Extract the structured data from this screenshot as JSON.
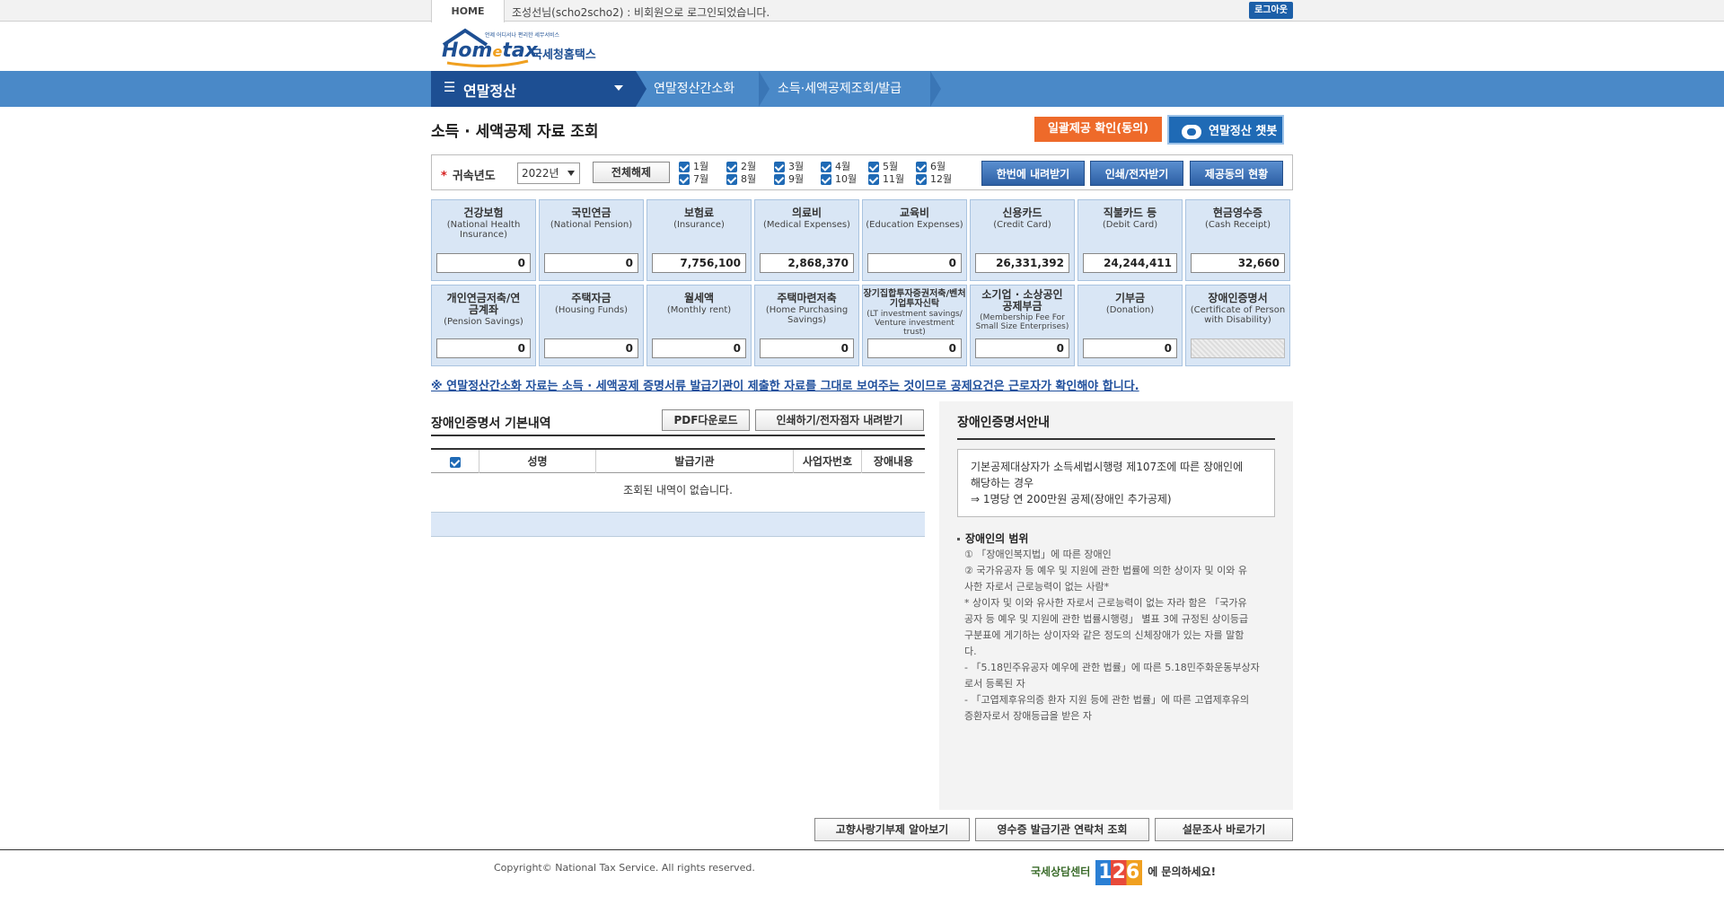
{
  "topbar": {
    "home": "HOME",
    "login_msg": "조성선님(scho2scho2) : 비회원으로 로그인되었습니다.",
    "logout": "로그아웃"
  },
  "logo": {
    "main_left": "Hom",
    "main_e": "e",
    "main_right": "tax",
    "korean": "국세청홈택스",
    "tagline": "언제 어디서나 편리한 세무서비스"
  },
  "nav": {
    "main": "연말정산",
    "crumbs": [
      "연말정산간소화",
      "소득·세액공제조회/발급"
    ]
  },
  "page": {
    "title": "소득 · 세액공제 자료 조회",
    "btn_consent": "일괄제공 확인(동의)",
    "btn_chatbot": "연말정산 챗봇"
  },
  "filter": {
    "label": "귀속년도",
    "year": "2022년",
    "btn_clear_all": "전체해제",
    "months": [
      "1월",
      "2월",
      "3월",
      "4월",
      "5월",
      "6월",
      "7월",
      "8월",
      "9월",
      "10월",
      "11월",
      "12월"
    ],
    "btn_download_all": "한번에 내려받기",
    "btn_print": "인쇄/전자받기",
    "btn_consent_status": "제공동의 현황"
  },
  "cards": [
    {
      "title": "건강보험",
      "en": "(National Health Insurance)",
      "value": "0"
    },
    {
      "title": "국민연금",
      "en": "(National Pension)",
      "value": "0"
    },
    {
      "title": "보험료",
      "en": "(Insurance)",
      "value": "7,756,100"
    },
    {
      "title": "의료비",
      "en": "(Medical Expenses)",
      "value": "2,868,370"
    },
    {
      "title": "교육비",
      "en": "(Education Expenses)",
      "value": "0"
    },
    {
      "title": "신용카드",
      "en": "(Credit Card)",
      "value": "26,331,392"
    },
    {
      "title": "직불카드 등",
      "en": "(Debit Card)",
      "value": "24,244,411"
    },
    {
      "title": "현금영수증",
      "en": "(Cash Receipt)",
      "value": "32,660"
    },
    {
      "title": "개인연금저축/연금계좌",
      "en": "(Pension Savings)",
      "value": "0"
    },
    {
      "title": "주택자금",
      "en": "(Housing Funds)",
      "value": "0"
    },
    {
      "title": "월세액",
      "en": "(Monthly rent)",
      "value": "0"
    },
    {
      "title": "주택마련저축",
      "en": "(Home Purchasing Savings)",
      "value": "0"
    },
    {
      "title": "장기집합투자증권저축/벤처기업투자신탁",
      "en": "(LT investment savings/ Venture investment trust)",
      "value": "0"
    },
    {
      "title": "소기업 · 소상공인 공제부금",
      "en": "(Membership Fee For Small Size Enterprises)",
      "value": "0"
    },
    {
      "title": "기부금",
      "en": "(Donation)",
      "value": "0"
    },
    {
      "title": "장애인증명서",
      "en": "(Certificate of Person with Disability)",
      "value": ""
    }
  ],
  "notice": "※ 연말정산간소화 자료는 소득 · 세액공제 증명서류 발급기관이 제출한 자료를 그대로 보여주는 것이므로 공제요건은 근로자가 확인해야 합니다.",
  "detail": {
    "title": "장애인증명서 기본내역",
    "btn_pdf": "PDF다운로드",
    "btn_print": "인쇄하기/전자점자 내려받기",
    "columns": [
      "성명",
      "발급기관",
      "사업자번호",
      "장애내용"
    ],
    "empty": "조회된 내역이 없습니다."
  },
  "guide": {
    "title": "장애인증명서안내",
    "box_line1": "기본공제대상자가 소득세법시행령 제107조에 따른 장애인에",
    "box_line2": "해당하는 경우",
    "box_line3": "⇒ 1명당 연 200만원 공제(장애인 추가공제)",
    "sub": "장애인의 범위",
    "lines": [
      "① 「장애인복지법」에 따른 장애인",
      "② 국가유공자 등 예우 및 지원에 관한 법률에 의한 상이자 및 이와 유",
      "사한 자로서 근로능력이 없는 사람*",
      "* 상이자 및 이와 유사한 자로서 근로능력이 없는 자라 함은 「국가유",
      "공자 등 예우 및 지원에 관한 법률시행령」 별표 3에 규정된 상이등급",
      "구분표에 게기하는 상이자와 같은 정도의 신체장애가 있는 자를 말함",
      "다.",
      "- 「5.18민주유공자 예우에 관한 법률」에 따른 5.18민주화운동부상자",
      "로서 등록된 자",
      "- 「고엽제후유의증 환자 지원 등에 관한 법률」에 따른 고엽제후유의",
      "증환자로서 장애등급을 받은 자"
    ]
  },
  "bottom_buttons": [
    "고향사랑기부제 알아보기",
    "영수증 발급기관 연락처 조회",
    "설문조사 바로가기"
  ],
  "footer": {
    "copyright": "Copyright© National Tax Service. All rights reserved.",
    "cc_label": "국세상담센터",
    "cc_num": "126",
    "cc_suffix": "에 문의하세요!"
  },
  "colors": {
    "nav_dark": "#1d4f93",
    "nav_light": "#4a89c8",
    "accent_orange": "#ee6a2a",
    "card_bg": "#d9e6f5"
  }
}
